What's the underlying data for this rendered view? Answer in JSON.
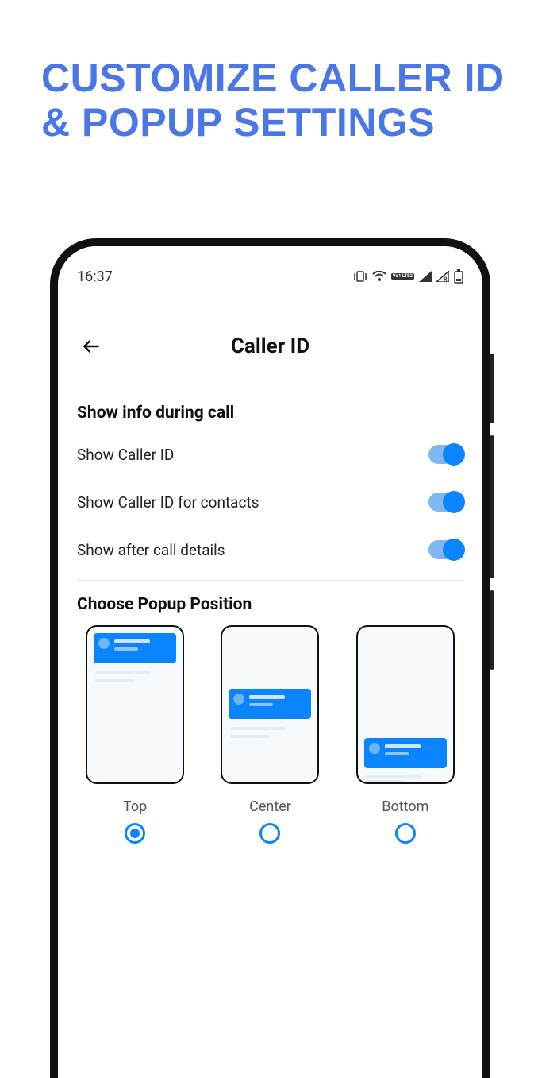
{
  "promo": {
    "title": "CUSTOMIZE CALLER ID & POPUP SETTINGS"
  },
  "status": {
    "time": "16:37",
    "vo_badge": "Vo1 LTE2"
  },
  "header": {
    "title": "Caller ID"
  },
  "sections": {
    "show_info_title": "Show info during call",
    "choose_position_title": "Choose Popup Position"
  },
  "settings": [
    {
      "label": "Show Caller ID",
      "on": true
    },
    {
      "label": "Show Caller ID for contacts",
      "on": true
    },
    {
      "label": "Show after call details",
      "on": true
    }
  ],
  "positions": [
    {
      "key": "top",
      "label": "Top",
      "selected": true
    },
    {
      "key": "center",
      "label": "Center",
      "selected": false
    },
    {
      "key": "bottom",
      "label": "Bottom",
      "selected": false
    }
  ]
}
